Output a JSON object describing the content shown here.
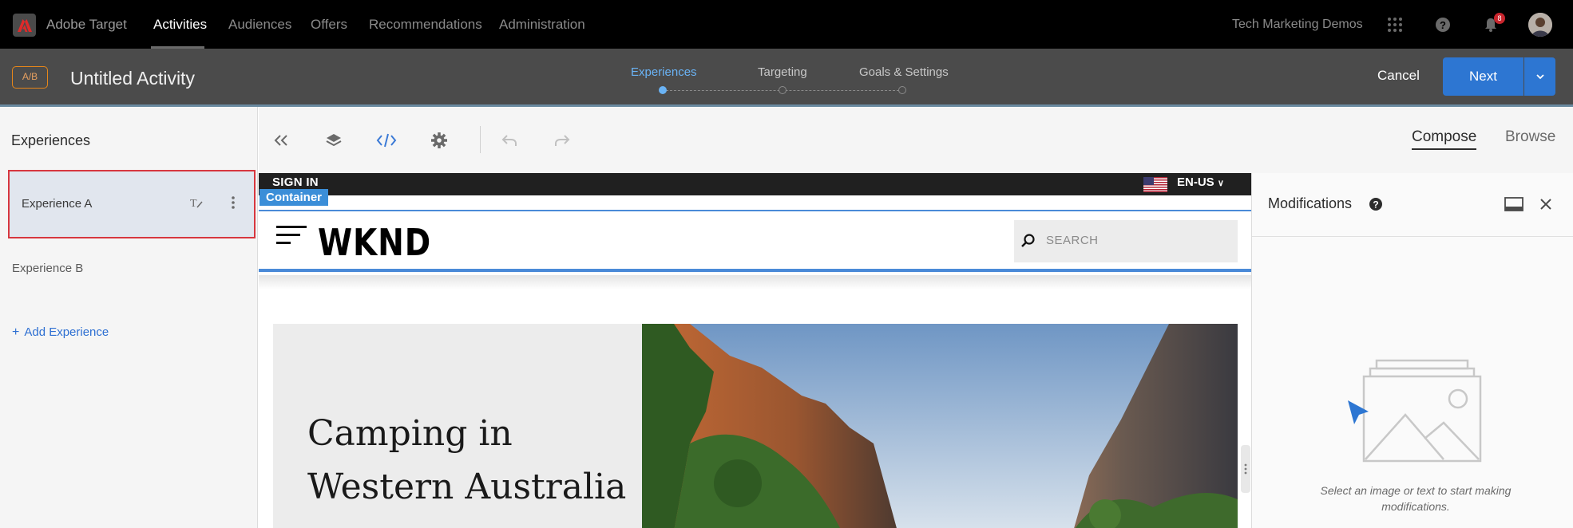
{
  "topnav": {
    "app_name": "Adobe Target",
    "items": [
      {
        "label": "Activities",
        "active": true
      },
      {
        "label": "Audiences"
      },
      {
        "label": "Offers"
      },
      {
        "label": "Recommendations"
      },
      {
        "label": "Administration"
      }
    ],
    "org_name": "Tech Marketing Demos",
    "notification_count": "8",
    "icons": [
      "apps-grid-icon",
      "help-icon",
      "bell-icon",
      "avatar"
    ]
  },
  "activity": {
    "type_badge": "A/B",
    "title": "Untitled Activity",
    "steps": [
      {
        "label": "Experiences",
        "active": true
      },
      {
        "label": "Targeting"
      },
      {
        "label": "Goals & Settings"
      }
    ],
    "cancel_label": "Cancel",
    "next_label": "Next"
  },
  "left_panel": {
    "title": "Experiences",
    "experiences": [
      {
        "label": "Experience A",
        "selected": true
      },
      {
        "label": "Experience B"
      }
    ],
    "add_label": "Add Experience"
  },
  "toolbar": {
    "tabs": [
      {
        "label": "Compose",
        "active": true
      },
      {
        "label": "Browse"
      }
    ]
  },
  "preview": {
    "sign_in": "SIGN IN",
    "language": "EN-US",
    "container_tag": "Container",
    "brand": "WKND",
    "search_placeholder": "SEARCH",
    "hero_title_line1": "Camping in",
    "hero_title_line2": "Western Australia"
  },
  "modifications": {
    "title": "Modifications",
    "empty_line1": "Select an image or text to start making",
    "empty_line2": "modifications."
  },
  "colors": {
    "accent_blue": "#2d76d2",
    "step_active": "#6ab3f5",
    "selection_border": "#d7373f",
    "ab_badge": "#e68619",
    "container_tag": "#3b8ed8"
  }
}
